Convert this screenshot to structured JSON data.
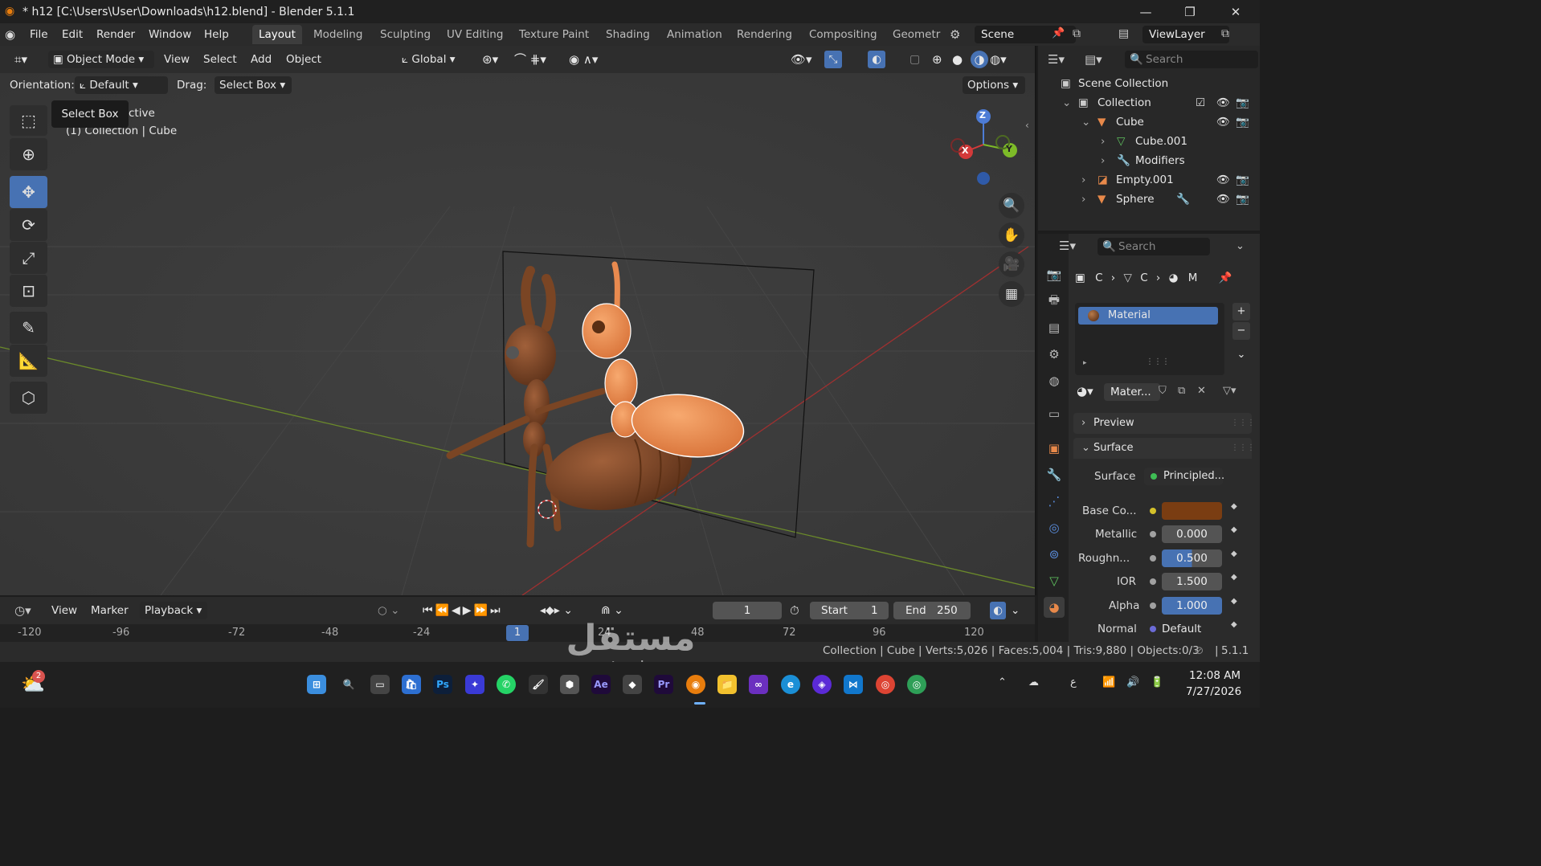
{
  "window": {
    "title": "* h12 [C:\\Users\\User\\Downloads\\h12.blend] - Blender 5.1.1",
    "minimize": "—",
    "maximize": "❐",
    "close": "✕"
  },
  "menu": {
    "file": "File",
    "edit": "Edit",
    "render": "Render",
    "window": "Window",
    "help": "Help"
  },
  "workspaces": [
    "Layout",
    "Modeling",
    "Sculpting",
    "UV Editing",
    "Texture Paint",
    "Shading",
    "Animation",
    "Rendering",
    "Compositing",
    "Geometr"
  ],
  "scene": {
    "name": "Scene",
    "view_layer": "ViewLayer"
  },
  "viewport": {
    "mode": "Object Mode",
    "menus": [
      "View",
      "Select",
      "Add",
      "Object"
    ],
    "transform_orientation": "Global",
    "orientation_label": "Orientation:",
    "orientation_value": "Default",
    "drag_label": "Drag:",
    "drag_value": "Select Box",
    "options": "Options",
    "tooltip": "Select Box",
    "view_name_suffix": "ctive",
    "context": "(1) Collection | Cube",
    "gizmo": {
      "z": "Z",
      "x": "X",
      "y": "Y"
    }
  },
  "outliner": {
    "search_placeholder": "Search",
    "scene_collection": "Scene Collection",
    "collection": "Collection",
    "cube": "Cube",
    "cube_mesh": "Cube.001",
    "modifiers": "Modifiers",
    "empty": "Empty.001",
    "sphere": "Sphere"
  },
  "properties": {
    "search_placeholder": "Search",
    "breadcrumb": [
      "C",
      "C",
      "M"
    ],
    "slot": "Material",
    "material_name": "Mater...",
    "preview": "Preview",
    "surface_panel": "Surface",
    "fields": [
      {
        "label": "Surface",
        "value": "Principled..."
      },
      {
        "label": "Base Co...",
        "value": ""
      },
      {
        "label": "Metallic",
        "value": "0.000"
      },
      {
        "label": "Roughn...",
        "value": "0.500"
      },
      {
        "label": "IOR",
        "value": "1.500"
      },
      {
        "label": "Alpha",
        "value": "1.000"
      },
      {
        "label": "Normal",
        "value": "Default"
      }
    ],
    "base_color": "#7a3d12"
  },
  "timeline": {
    "menus": [
      "View",
      "Marker",
      "Playback"
    ],
    "current_frame": "1",
    "start_label": "Start",
    "start": "1",
    "end_label": "End",
    "end": "250",
    "ruler": [
      "-120",
      "-96",
      "-72",
      "-48",
      "-24",
      "1",
      "24",
      "48",
      "72",
      "96",
      "120"
    ]
  },
  "status": {
    "text": "Collection | Cube | Verts:5,026 | Faces:5,004 | Tris:9,880 | Objects:0/3",
    "version": "5.1.1"
  },
  "taskbar": {
    "time": "12:08 AM",
    "date": "7/27/2026",
    "lang": "ع",
    "weather_badge": "2"
  },
  "watermark": {
    "arabic": "مستقل",
    "latin": "mostaql.com"
  },
  "colors": {
    "accent": "#4772b3",
    "ant_dark": "#7a4524",
    "ant_light": "#e88a4f"
  }
}
